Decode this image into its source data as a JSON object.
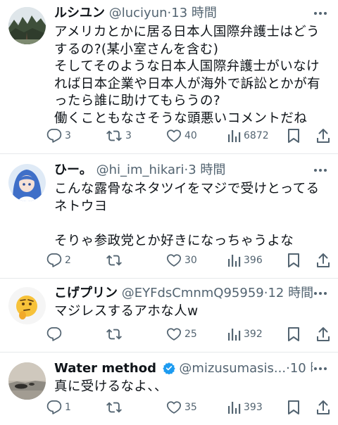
{
  "tweets": [
    {
      "name": "ルシユン",
      "handle": "@luciyun",
      "separator": "·",
      "time": "13 時間",
      "text": "アメリカとかに居る日本人国際弁護士はどうするの?(某小室さんを含む)\nそしてそのような日本人国際弁護士がいなければ日本企業や日本人が海外で訴訟とかが有ったら誰に助けてもらうの?\n働くこともなさそうな頭悪いコメントだね",
      "replies": "3",
      "retweets": "3",
      "likes": "40",
      "views": "6872"
    },
    {
      "name": "ひー。",
      "handle": "@hi_im_hikari",
      "separator": "·",
      "time": "3 時間",
      "text": "こんな露骨なネタツイをマジで受けとってるネトウヨ\n\nそりゃ参政党とか好きになっちゃうよな",
      "replies": "2",
      "retweets": "",
      "likes": "30",
      "views": "396"
    },
    {
      "name": "こげプリン",
      "handle": "@EYFdsCmnmQ95959",
      "separator": "·",
      "time": "12 時間",
      "text": "マジレスするアホな人w",
      "replies": "",
      "retweets": "",
      "likes": "25",
      "views": "392"
    },
    {
      "name": "Water method",
      "handle": "@mizusumasis...",
      "separator": "·",
      "time": "10 時間",
      "text": "真に受けるなよ、、",
      "replies": "1",
      "retweets": "",
      "likes": "35",
      "views": "393"
    }
  ],
  "icons": {
    "more": "more-icon",
    "reply": "reply-icon",
    "retweet": "retweet-icon",
    "like": "heart-icon",
    "views": "views-icon",
    "bookmark": "bookmark-icon",
    "share": "share-icon",
    "verified": "verified-badge-icon"
  },
  "colors": {
    "text": "#0f1419",
    "secondary": "#536471",
    "verified": "#1d9bf0",
    "divider": "#e6e9eb"
  }
}
